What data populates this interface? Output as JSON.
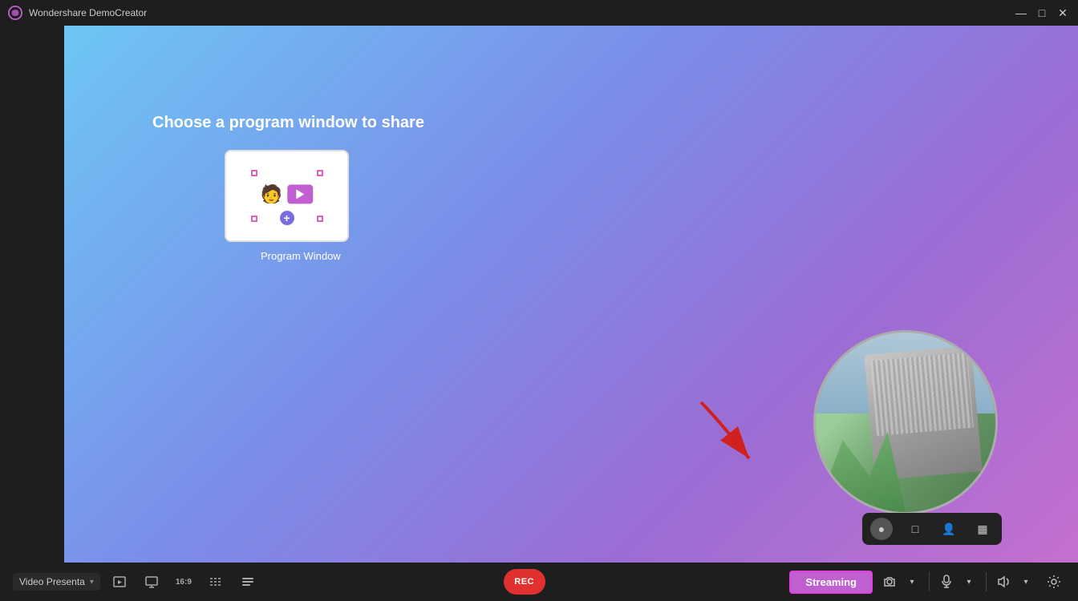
{
  "app": {
    "title": "Wondershare DemoCreator",
    "logo_symbol": "🎨"
  },
  "titlebar": {
    "minimize": "—",
    "maximize": "□",
    "close": "✕"
  },
  "main": {
    "choose_title": "Choose a program window to share",
    "program_window_label": "Program Window"
  },
  "camera_toolbar": {
    "circle_icon": "●",
    "rect_icon": "□",
    "person_icon": "👤",
    "layout_icon": "▦"
  },
  "bottom_bar": {
    "source_label": "Video Presenta",
    "rec_label": "REC",
    "streaming_label": "Streaming",
    "icons": {
      "scene": "🎬",
      "screen": "🖥",
      "aspect": "16:9",
      "motion": "≋",
      "text": "≡"
    }
  },
  "bottom_right": {
    "camera_icon": "🎙",
    "mic_icon": "🎤",
    "volume_icon": "🔊",
    "settings_icon": "⚙"
  }
}
